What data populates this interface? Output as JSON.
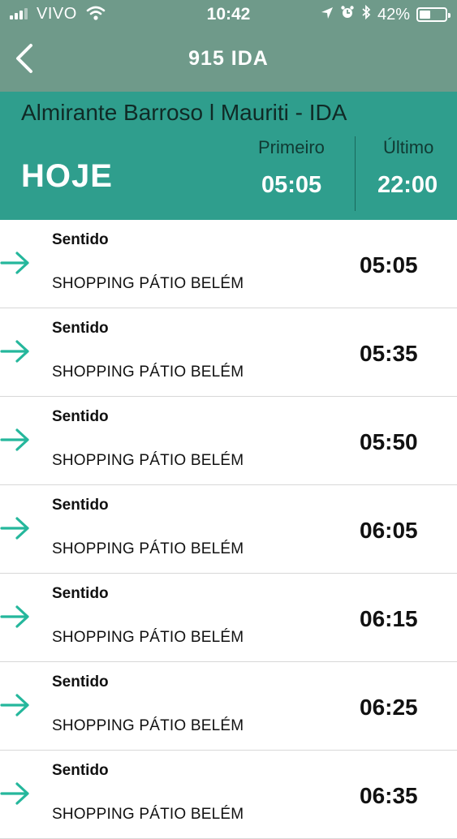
{
  "status_bar": {
    "carrier": "VIVO",
    "time": "10:42",
    "battery": "42%",
    "battery_level": 0.42,
    "signal_bars": 3
  },
  "nav": {
    "back_icon": "chevron-left-icon",
    "title": "915 IDA"
  },
  "summary": {
    "route_name": "Almirante Barroso l Mauriti - IDA",
    "day_label": "HOJE",
    "first_label": "Primeiro",
    "first_time": "05:05",
    "last_label": "Último",
    "last_time": "22:00"
  },
  "colors": {
    "nav_bg": "#6f9a8a",
    "header_bg": "#2f9e8d",
    "arrow": "#25b79c"
  },
  "departures": [
    {
      "direction_label": "Sentido",
      "destination": "SHOPPING PÁTIO BELÉM",
      "time": "05:05"
    },
    {
      "direction_label": "Sentido",
      "destination": "SHOPPING PÁTIO BELÉM",
      "time": "05:35"
    },
    {
      "direction_label": "Sentido",
      "destination": "SHOPPING PÁTIO BELÉM",
      "time": "05:50"
    },
    {
      "direction_label": "Sentido",
      "destination": "SHOPPING PÁTIO BELÉM",
      "time": "06:05"
    },
    {
      "direction_label": "Sentido",
      "destination": "SHOPPING PÁTIO BELÉM",
      "time": "06:15"
    },
    {
      "direction_label": "Sentido",
      "destination": "SHOPPING PÁTIO BELÉM",
      "time": "06:25"
    },
    {
      "direction_label": "Sentido",
      "destination": "SHOPPING PÁTIO BELÉM",
      "time": "06:35"
    }
  ]
}
